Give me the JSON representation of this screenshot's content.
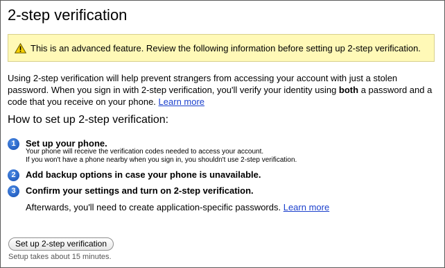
{
  "page": {
    "title": "2-step verification"
  },
  "warning": {
    "icon": "warning-icon",
    "text": "This is an advanced feature. Review the following information before setting up 2-step verification."
  },
  "intro": {
    "part1": "Using 2-step verification will help prevent strangers from accessing your account with just a stolen password. When you sign in with 2-step verification, you'll verify your identity using ",
    "bold": "both",
    "part2": " a password and a code that you receive on your phone. ",
    "link": "Learn more"
  },
  "howto": {
    "heading": "How to set up 2-step verification:",
    "steps": [
      {
        "number": "1",
        "title": "Set up your phone.",
        "desc1": "Your phone will receive the verification codes needed to access your account.",
        "desc2": "If you won't have a phone nearby when you sign in, you shouldn't use 2-step verification."
      },
      {
        "number": "2",
        "title": "Add backup options in case your phone is unavailable."
      },
      {
        "number": "3",
        "title": "Confirm your settings and turn on 2-step verification."
      }
    ],
    "after_text": "Afterwards, you'll need to create application-specific passwords. ",
    "after_link": "Learn more"
  },
  "setup": {
    "button_label": "Set up 2-step verification",
    "note": "Setup takes about 15 minutes."
  },
  "colors": {
    "warning_bg": "#fff9b7",
    "link": "#1a3fcc",
    "step_badge": "#2460c2"
  }
}
